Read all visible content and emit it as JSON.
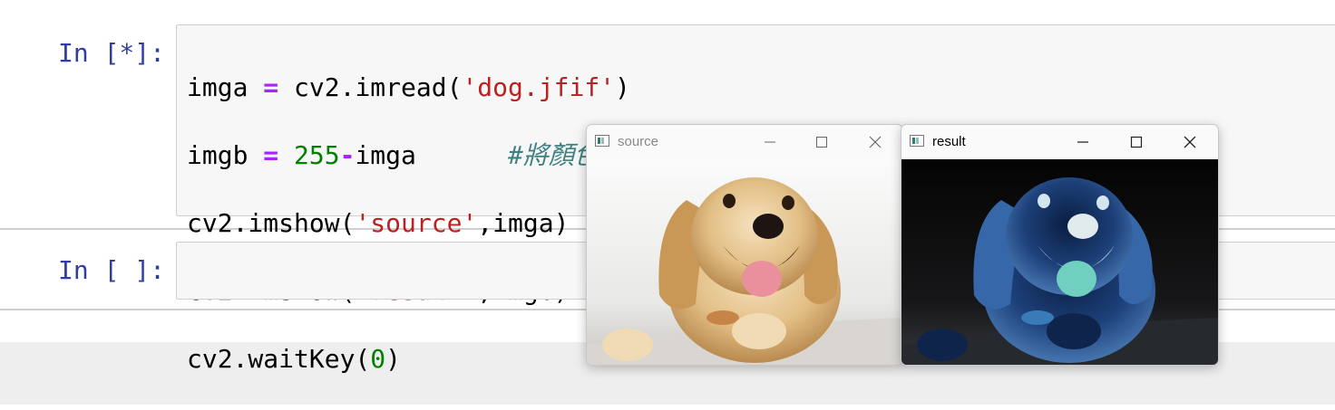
{
  "notebook": {
    "cells": [
      {
        "prompt": "In [*]:",
        "lines": [
          [
            "imga ",
            "= ",
            "cv2.imread(",
            "'dog.jfif'",
            ")"
          ],
          [
            "imgb ",
            "= ",
            "255",
            "-",
            "imga      ",
            "#將顏色0->255(負片轉換)"
          ],
          [
            "cv2.imshow(",
            "'source'",
            ",imga)"
          ],
          [
            "cv2.imshow(",
            "'result'",
            ",imgb)"
          ],
          [
            "cv2.waitKey(",
            "0",
            ")"
          ]
        ]
      },
      {
        "prompt": "In [ ]:",
        "lines": []
      }
    ]
  },
  "windows": [
    {
      "title": "source",
      "image": "golden-retriever-puppy-photo"
    },
    {
      "title": "result",
      "image": "negative-inverted-puppy-photo"
    }
  ],
  "icons": {
    "app": "opencv-window-icon",
    "minimize": "minimize-icon",
    "maximize": "maximize-icon",
    "close": "close-icon"
  },
  "colors": {
    "prompt": "#303f9f",
    "operator": "#aa22ff",
    "string": "#ba2121",
    "number": "#008000",
    "comment": "#408080"
  }
}
